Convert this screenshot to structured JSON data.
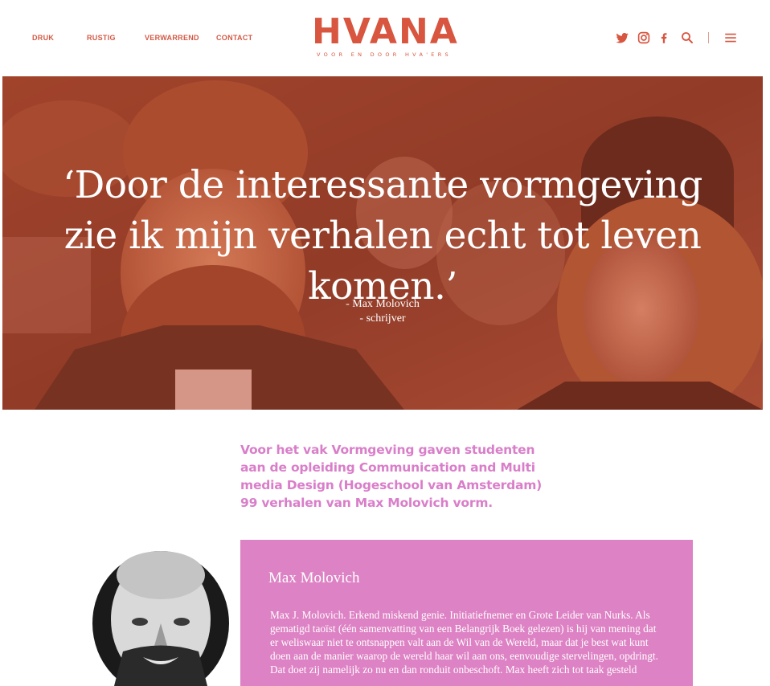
{
  "nav": {
    "items": [
      {
        "label": "DRUK"
      },
      {
        "label": "RUSTIG"
      },
      {
        "label": "VERWARREND"
      },
      {
        "label": "CONTACT"
      }
    ]
  },
  "logo": {
    "text": "HVANA",
    "tagline": "VOOR EN DOOR HVA'ERS"
  },
  "social_icons": [
    "twitter-icon",
    "instagram-icon",
    "facebook-icon",
    "search-icon",
    "menu-icon"
  ],
  "colors": {
    "brand": "#d8553f",
    "accent_pink": "#dd82c4",
    "intro_text": "#d97ec9"
  },
  "hero": {
    "quote": "‘Door de interessante vormgeving zie ik mijn verhalen echt tot leven komen.’",
    "author": "- Max Molovich",
    "role": "- schrijver"
  },
  "intro": {
    "text": "Voor het vak Vormgeving gaven studenten aan de opleiding Communication and Multi media Design (Hogeschool van Amsterdam) 99 verhalen van Max Molovich vorm."
  },
  "bio": {
    "name": "Max Molovich",
    "text": "Max J. Molovich. Erkend miskend genie. Initiatiefnemer en Grote Leider van Nurks. Als gematigd taoïst (één samenvatting van een Belangrijk Boek gelezen) is hij van mening dat er weliswaar niet te ontsnappen valt aan de Wil van de Wereld, maar dat je best wat kunt doen aan de manier waarop de wereld haar wil aan ons, eenvoudige stervelingen, opdringt. Dat doet zij namelijk zo nu en dan ronduit onbeschoft. Max heeft zich tot taak gesteld"
  }
}
